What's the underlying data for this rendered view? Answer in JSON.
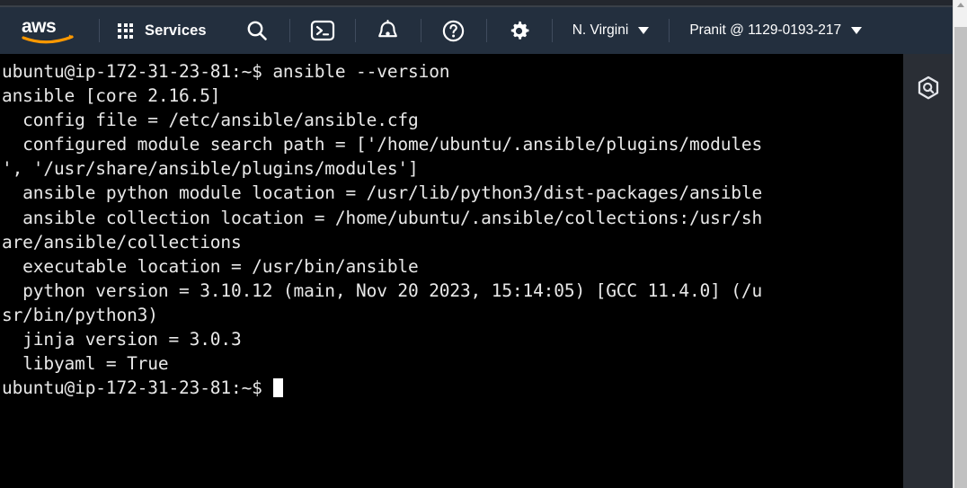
{
  "header": {
    "logo_alt": "aws",
    "services_label": "Services",
    "search_icon": "search-icon",
    "cloudshell_icon": "cloudshell-icon",
    "notifications_icon": "bell-icon",
    "help_icon": "question-circle-icon",
    "settings_icon": "gear-icon",
    "region_label": "N. Virgini",
    "account_label": "Pranit @ 1129-0193-217",
    "bg_color": "#232f3e"
  },
  "right_rail": {
    "q_icon": "amazon-q-hexagon-icon",
    "bg_color": "#2a2e35"
  },
  "terminal": {
    "bg_color": "#000000",
    "text_color": "#e8e8e8",
    "prompt": "ubuntu@ip-172-31-23-81:~$",
    "command": "ansible --version",
    "lines": [
      "ubuntu@ip-172-31-23-81:~$ ansible --version",
      "ansible [core 2.16.5]",
      "  config file = /etc/ansible/ansible.cfg",
      "  configured module search path = ['/home/ubuntu/.ansible/plugins/modules",
      "', '/usr/share/ansible/plugins/modules']",
      "  ansible python module location = /usr/lib/python3/dist-packages/ansible",
      "  ansible collection location = /home/ubuntu/.ansible/collections:/usr/sh",
      "are/ansible/collections",
      "  executable location = /usr/bin/ansible",
      "  python version = 3.10.12 (main, Nov 20 2023, 15:14:05) [GCC 11.4.0] (/u",
      "sr/bin/python3)",
      "  jinja version = 3.0.3",
      "  libyaml = True"
    ],
    "final_prompt": "ubuntu@ip-172-31-23-81:~$ "
  },
  "scrollbar": {
    "track_color": "#f1f1f1",
    "thumb_color": "#c1c1c1"
  }
}
